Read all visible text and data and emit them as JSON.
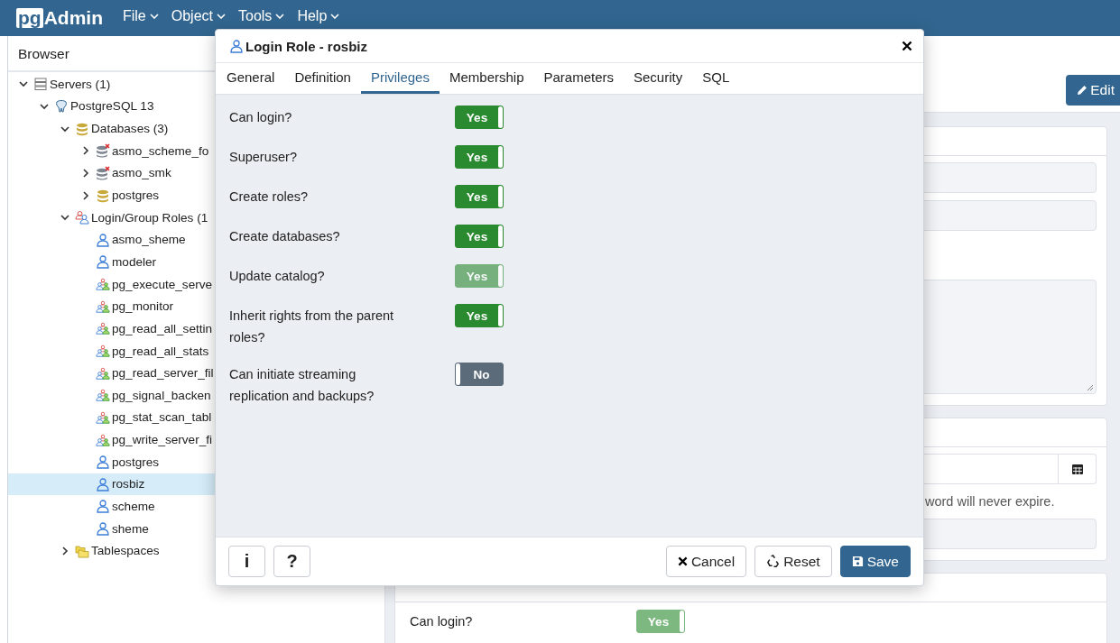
{
  "app": {
    "logo_mark": "pg",
    "logo_text": "Admin",
    "menu": [
      {
        "label": "File"
      },
      {
        "label": "Object"
      },
      {
        "label": "Tools"
      },
      {
        "label": "Help"
      }
    ]
  },
  "browser": {
    "title": "Browser",
    "tree": [
      {
        "label": "Servers (1)",
        "kind": "servers",
        "expanded": true,
        "selected": false,
        "children": [
          {
            "label": "PostgreSQL 13",
            "kind": "server",
            "expanded": true,
            "selected": false,
            "children": [
              {
                "label": "Databases (3)",
                "kind": "databases",
                "expanded": true,
                "selected": false,
                "children": [
                  {
                    "label": "asmo_scheme_fo",
                    "kind": "offline-database",
                    "expanded": false,
                    "selected": false
                  },
                  {
                    "label": "asmo_smk",
                    "kind": "offline-database",
                    "expanded": false,
                    "selected": false
                  },
                  {
                    "label": "postgres",
                    "kind": "database",
                    "expanded": false,
                    "selected": false
                  }
                ]
              },
              {
                "label": "Login/Group Roles (1",
                "kind": "roles",
                "expanded": true,
                "selected": false,
                "children": [
                  {
                    "label": "asmo_sheme",
                    "kind": "login-role",
                    "selected": false
                  },
                  {
                    "label": "modeler",
                    "kind": "login-role",
                    "selected": false
                  },
                  {
                    "label": "pg_execute_serve",
                    "kind": "group-role",
                    "selected": false
                  },
                  {
                    "label": "pg_monitor",
                    "kind": "group-role",
                    "selected": false
                  },
                  {
                    "label": "pg_read_all_settin",
                    "kind": "group-role",
                    "selected": false
                  },
                  {
                    "label": "pg_read_all_stats",
                    "kind": "group-role",
                    "selected": false
                  },
                  {
                    "label": "pg_read_server_fil",
                    "kind": "group-role",
                    "selected": false
                  },
                  {
                    "label": "pg_signal_backen",
                    "kind": "group-role",
                    "selected": false
                  },
                  {
                    "label": "pg_stat_scan_tabl",
                    "kind": "group-role",
                    "selected": false
                  },
                  {
                    "label": "pg_write_server_fi",
                    "kind": "group-role",
                    "selected": false
                  },
                  {
                    "label": "postgres",
                    "kind": "login-role",
                    "selected": false
                  },
                  {
                    "label": "rosbiz",
                    "kind": "login-role",
                    "selected": true
                  },
                  {
                    "label": "scheme",
                    "kind": "login-role",
                    "selected": false
                  },
                  {
                    "label": "sheme",
                    "kind": "login-role",
                    "selected": false
                  }
                ]
              },
              {
                "label": "Tablespaces",
                "kind": "tablespaces",
                "expanded": false,
                "selected": false
              }
            ]
          }
        ]
      }
    ]
  },
  "properties": {
    "edit_button": "Edit",
    "help_text": "word will never expire.",
    "privileges": [
      {
        "label": "Can login?",
        "value": "Yes",
        "on": true,
        "disabled": true
      }
    ]
  },
  "dialog": {
    "title": "Login Role - rosbiz",
    "tabs": [
      {
        "label": "General",
        "selected": false
      },
      {
        "label": "Definition",
        "selected": false
      },
      {
        "label": "Privileges",
        "selected": true
      },
      {
        "label": "Membership",
        "selected": false
      },
      {
        "label": "Parameters",
        "selected": false
      },
      {
        "label": "Security",
        "selected": false
      },
      {
        "label": "SQL",
        "selected": false
      }
    ],
    "privileges": [
      {
        "label": "Can login?",
        "value": "Yes",
        "on": true,
        "disabled": false
      },
      {
        "label": "Superuser?",
        "value": "Yes",
        "on": true,
        "disabled": false
      },
      {
        "label": "Create roles?",
        "value": "Yes",
        "on": true,
        "disabled": false
      },
      {
        "label": "Create databases?",
        "value": "Yes",
        "on": true,
        "disabled": false
      },
      {
        "label": "Update catalog?",
        "value": "Yes",
        "on": true,
        "disabled": true
      },
      {
        "label": "Inherit rights from the parent roles?",
        "value": "Yes",
        "on": true,
        "disabled": false
      },
      {
        "label": "Can initiate streaming replication and backups?",
        "value": "No",
        "on": false,
        "disabled": false
      }
    ],
    "info_button": "i",
    "help_button": "?",
    "cancel_button": "Cancel",
    "reset_button": "Reset",
    "save_button": "Save"
  }
}
